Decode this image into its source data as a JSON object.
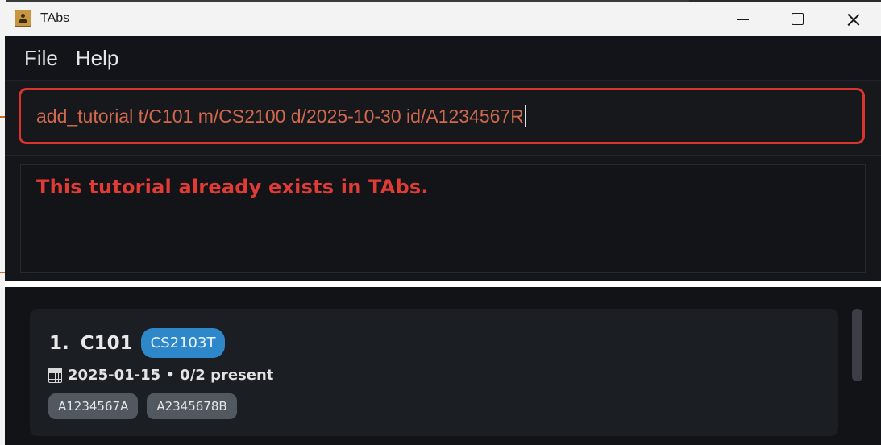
{
  "window": {
    "title": "TAbs"
  },
  "menu": {
    "items": [
      "File",
      "Help"
    ]
  },
  "command": {
    "value": "add_tutorial t/C101 m/CS2100 d/2025-10-30 id/A1234567R"
  },
  "result": {
    "message": "This tutorial already exists in TAbs."
  },
  "tutorials": [
    {
      "index": "1.",
      "id": "C101",
      "module": "CS2103T",
      "info": "2025-01-15 • 0/2 present",
      "students": [
        "A1234567A",
        "A2345678B"
      ]
    }
  ],
  "colors": {
    "error": "#e03b35",
    "command_border": "#d9352e",
    "module_badge": "#2d87c9"
  }
}
